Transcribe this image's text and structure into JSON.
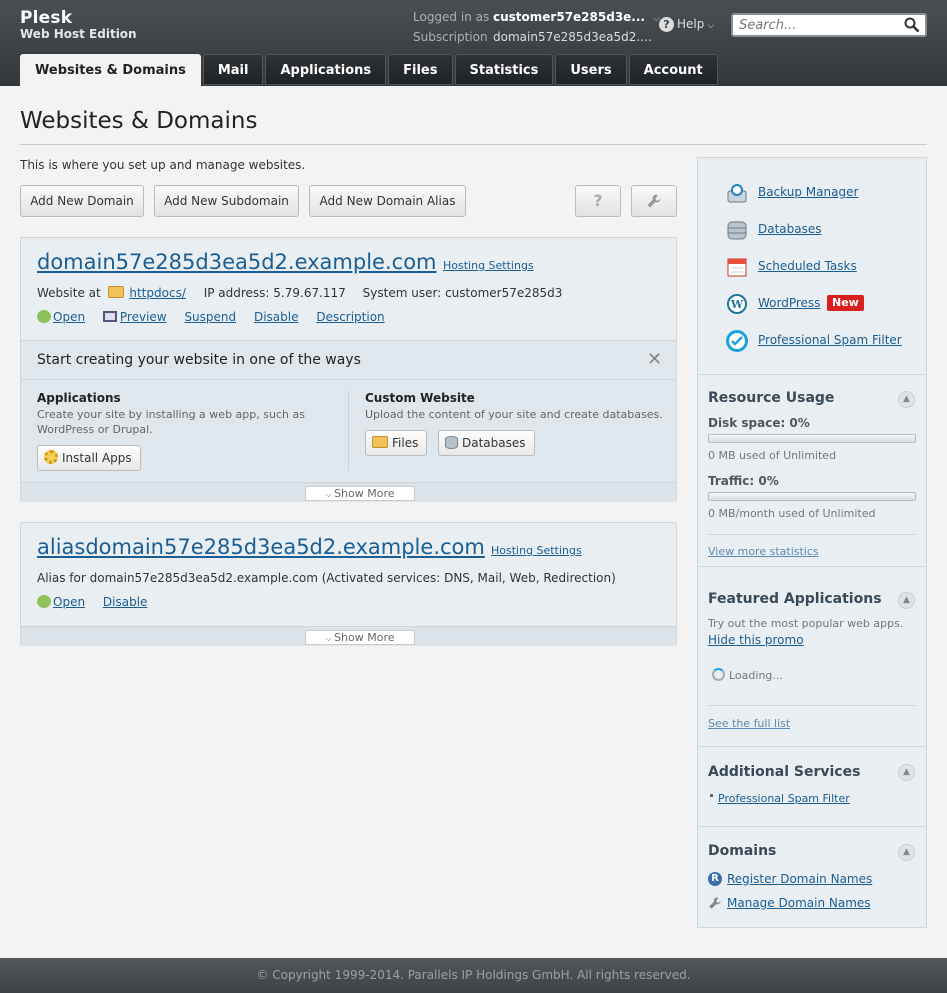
{
  "brand": {
    "name": "Plesk",
    "edition": "Web Host Edition"
  },
  "account": {
    "logged_in_label": "Logged in as",
    "logged_in_value": "customer57e285d3e...",
    "subscription_label": "Subscription",
    "subscription_value": "domain57e285d3ea5d2...."
  },
  "help": {
    "label": "Help"
  },
  "search": {
    "placeholder": "Search..."
  },
  "tabs": [
    "Websites & Domains",
    "Mail",
    "Applications",
    "Files",
    "Statistics",
    "Users",
    "Account"
  ],
  "page": {
    "title": "Websites & Domains",
    "intro": "This is where you set up and manage websites."
  },
  "toolbar": {
    "add_domain": "Add New Domain",
    "add_subdomain": "Add New Subdomain",
    "add_alias": "Add New Domain Alias",
    "help_glyph": "?",
    "settings_icon": "wrench-icon"
  },
  "domains": [
    {
      "name": "domain57e285d3ea5d2.example.com",
      "hosting_settings": "Hosting Settings",
      "website_at_label": "Website at",
      "docroot": "httpdocs/",
      "ip_label": "IP address:",
      "ip": "5.79.67.117",
      "sysuser_label": "System user:",
      "sysuser": "customer57e285d3",
      "actions": [
        "Open",
        "Preview",
        "Suspend",
        "Disable",
        "Description"
      ],
      "show_more": "Show More"
    },
    {
      "name": "aliasdomain57e285d3ea5d2.example.com",
      "hosting_settings": "Hosting Settings",
      "alias_text": "Alias for domain57e285d3ea5d2.example.com (Activated services: DNS, Mail, Web, Redirection)",
      "actions": [
        "Open",
        "Disable"
      ],
      "show_more": "Show More"
    }
  ],
  "wizard": {
    "title": "Start creating your website in one of the ways",
    "applications": {
      "heading": "Applications",
      "desc": "Create your site by installing a web app, such as WordPress or Drupal.",
      "button": "Install Apps"
    },
    "custom": {
      "heading": "Custom Website",
      "desc": "Upload the content of your site and create databases.",
      "files_button": "Files",
      "databases_button": "Databases"
    }
  },
  "sidebar": {
    "tools": [
      "Backup Manager",
      "Databases",
      "Scheduled Tasks",
      "WordPress",
      "Professional Spam Filter"
    ],
    "new_badge": "New",
    "resource_usage": {
      "title": "Resource Usage",
      "disk_label": "Disk space: 0%",
      "disk_percent": 0,
      "disk_note": "0 MB used of Unlimited",
      "traffic_label": "Traffic: 0%",
      "traffic_percent": 0,
      "traffic_note": "0 MB/month used of Unlimited",
      "more_link": "View more statistics"
    },
    "featured": {
      "title": "Featured Applications",
      "desc": "Try out the most popular web apps.",
      "hide_link": "Hide this promo",
      "loading": "Loading...",
      "full_list": "See the full list"
    },
    "additional": {
      "title": "Additional Services",
      "items": [
        "Professional Spam Filter"
      ]
    },
    "domains": {
      "title": "Domains",
      "register": "Register Domain Names",
      "manage": "Manage Domain Names"
    }
  },
  "footer": {
    "copyright": "© Copyright 1999-2014. Parallels IP Holdings GmbH. All rights reserved."
  }
}
